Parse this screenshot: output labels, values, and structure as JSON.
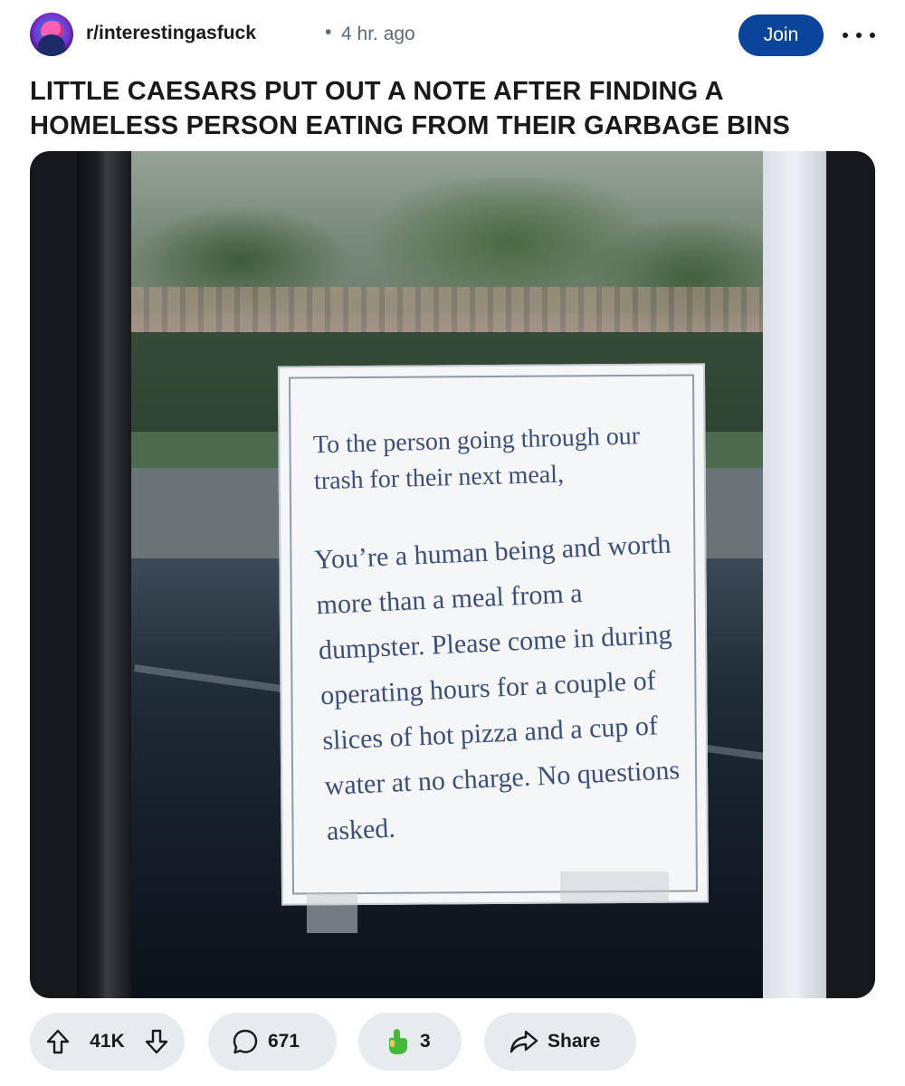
{
  "post": {
    "subreddit": "r/interestingasfuck",
    "separator": "•",
    "time_ago": "4 hr. ago",
    "join_label": "Join",
    "title": "LITTLE CAESARS PUT OUT A NOTE AFTER FINDING A HOMELESS PERSON EATING FROM THEIR GARBAGE BINS"
  },
  "image": {
    "note_greeting": "To the person going through our trash for their next meal,",
    "note_body": "You’re a human being and worth more than a meal from a dumpster. Please come in during operating hours for a couple of slices of hot pizza and a cup of water at no charge. No questions asked."
  },
  "actions": {
    "votes": "41K",
    "comments": "671",
    "awards": "3",
    "share_label": "Share"
  },
  "icons": {
    "upvote": "arrow-up-icon",
    "downvote": "arrow-down-icon",
    "comment": "speech-bubble-icon",
    "award": "pointing-hand-icon",
    "share": "share-arrow-icon",
    "more": "ellipsis-icon"
  },
  "colors": {
    "join_button": "#0a449b",
    "pill_background": "#e5ebee",
    "award_icon": "#46b93a"
  }
}
